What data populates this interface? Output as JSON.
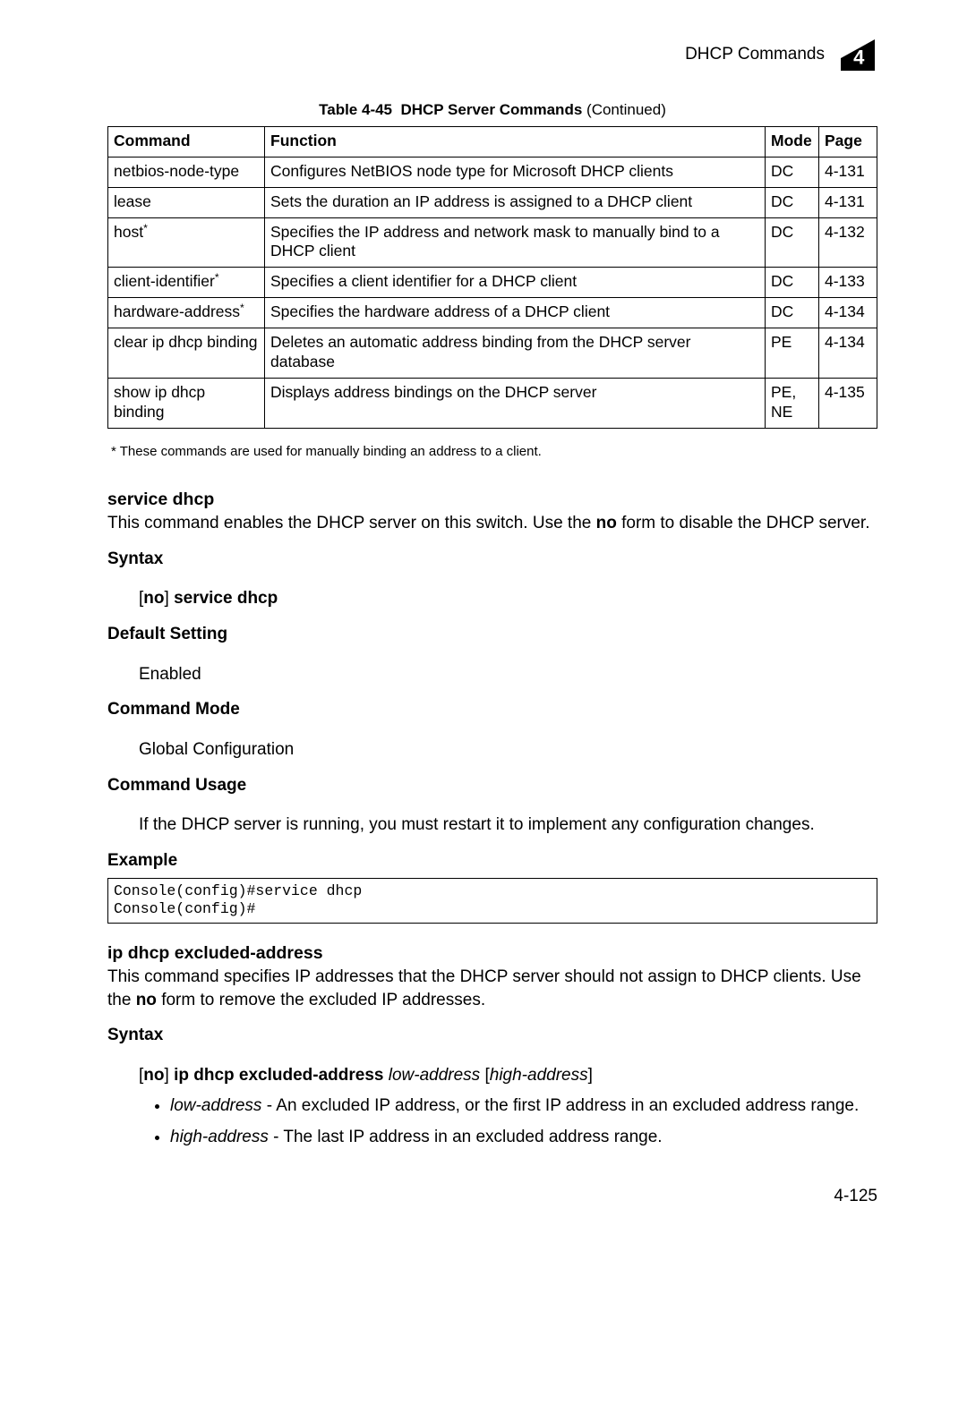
{
  "header": {
    "title": "DHCP Commands",
    "chapter": "4"
  },
  "tableCaption": {
    "label": "Table 4-45",
    "title": "DHCP Server Commands",
    "suffix": "(Continued)"
  },
  "tableHeaders": {
    "cmd": "Command",
    "func": "Function",
    "mode": "Mode",
    "page": "Page"
  },
  "rows": [
    {
      "cmd": "netbios-node-type",
      "func": "Configures NetBIOS node type for Microsoft DHCP clients",
      "mode": "DC",
      "page": "4-131"
    },
    {
      "cmd": "lease",
      "func": "Sets the duration an IP address is assigned to a DHCP client",
      "mode": "DC",
      "page": "4-131"
    },
    {
      "cmd": "host*",
      "func": "Specifies the IP address and network mask to manually bind to a DHCP client",
      "mode": "DC",
      "page": "4-132"
    },
    {
      "cmd": "client-identifier*",
      "func": "Specifies a client identifier for a DHCP client",
      "mode": "DC",
      "page": "4-133"
    },
    {
      "cmd": "hardware-address*",
      "func": "Specifies the hardware address of a DHCP client",
      "mode": "DC",
      "page": "4-134"
    },
    {
      "cmd": "clear ip dhcp binding",
      "func": "Deletes an automatic address binding from the DHCP server database",
      "mode": "PE",
      "page": "4-134"
    },
    {
      "cmd": "show ip dhcp binding",
      "func": "Displays address bindings on the DHCP server",
      "mode": "PE, NE",
      "page": "4-135"
    }
  ],
  "footnote": "* These commands are used for manually binding an address to a client.",
  "svc": {
    "heading": "service dhcp",
    "desc_pre": "This command enables the DHCP server on this switch. Use the ",
    "no": "no",
    "desc_post": " form to disable the DHCP server.",
    "syntaxHead": "Syntax",
    "syntax_cmd": "service dhcp",
    "defaultHead": "Default Setting",
    "defaultVal": "Enabled",
    "modeHead": "Command Mode",
    "modeVal": "Global Configuration",
    "usageHead": "Command Usage",
    "usageVal": "If the DHCP server is running, you must restart it to implement any configuration changes.",
    "exampleHead": "Example",
    "exampleCode": "Console(config)#service dhcp\nConsole(config)#"
  },
  "exa": {
    "heading": "ip dhcp excluded-address",
    "desc_pre": "This command specifies IP addresses that the DHCP server should not assign to DHCP clients. Use the ",
    "desc_post": " form to remove the excluded IP addresses.",
    "syntaxHead": "Syntax",
    "syntax_cmd": "ip dhcp excluded-address",
    "low": "low-address",
    "high": "high-address",
    "lowDesc": " - An excluded IP address, or the first IP address in an excluded address range.",
    "highDesc": " - The last IP address in an excluded address range."
  },
  "pageNumber": "4-125"
}
